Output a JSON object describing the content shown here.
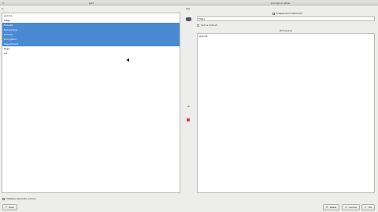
{
  "windows": {
    "left_title": "gui?",
    "right_title": "gui.sign-in-show"
  },
  "list": {
    "header": "Ic",
    "items": [
      {
        "label": "gnome",
        "selected": false
      },
      {
        "label": "Mage",
        "selected": false
      },
      {
        "label": "Firewall",
        "selected": true
      },
      {
        "label": "Networking",
        "selected": true
      },
      {
        "label": "Service",
        "selected": true
      },
      {
        "label": "Encryption",
        "selected": true
      },
      {
        "label": "Department",
        "selected": true
      },
      {
        "label": "Page",
        "selected": false
      },
      {
        "label": "nif",
        "selected": false
      }
    ]
  },
  "middle": {
    "add_icon": "arrow-right-icon",
    "remove_icon": "trash-icon"
  },
  "right": {
    "top_label": "Mgr",
    "independent_label": "Independent elements",
    "name_value": "Mage",
    "default_label": "Set as default",
    "mime_header": "Mimetypes",
    "mime_items": [
      "gnome"
    ]
  },
  "footer": {
    "multi_label": "Multiple separate entries",
    "help_label": "Help",
    "reset_label": "Reset",
    "cancel_label": "Cancel",
    "ok_label": "OK"
  },
  "colors": {
    "selection": "#4a8ad3",
    "background": "#ededeb"
  }
}
